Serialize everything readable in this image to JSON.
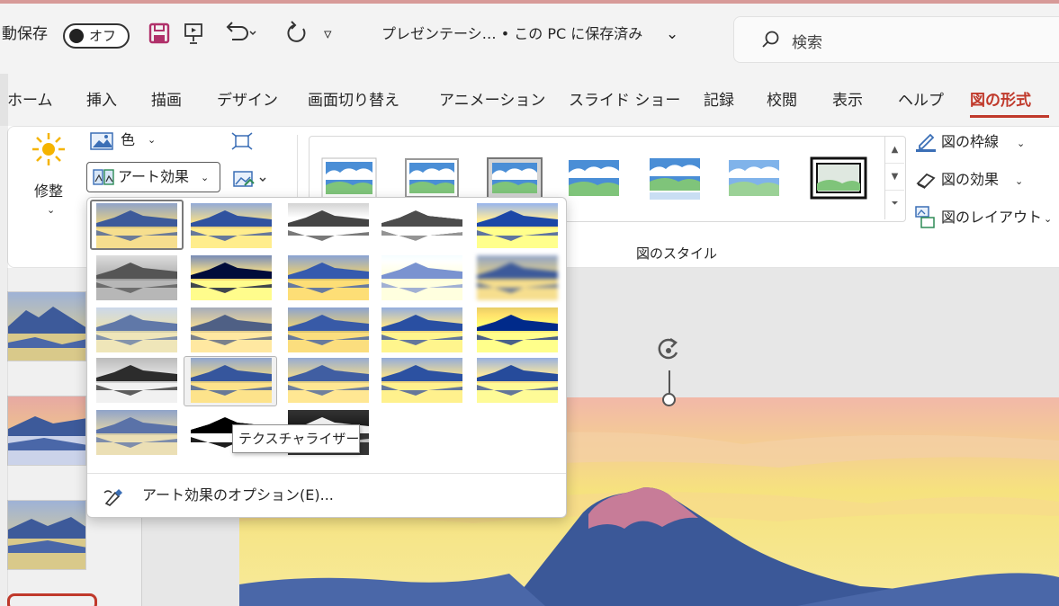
{
  "titlebar": {
    "autosave_label": "動保存",
    "toggle_label": "オフ",
    "document_title": "プレゼンテーシ… • この PC に保存済み",
    "title_chevron": "⌄",
    "search_placeholder": "検索",
    "qat_more": "▿"
  },
  "tabs": [
    {
      "label": "ホーム"
    },
    {
      "label": "挿入"
    },
    {
      "label": "描画"
    },
    {
      "label": "デザイン"
    },
    {
      "label": "画面切り替え"
    },
    {
      "label": "アニメーション"
    },
    {
      "label": "スライド ショー"
    },
    {
      "label": "記録"
    },
    {
      "label": "校閲"
    },
    {
      "label": "表示"
    },
    {
      "label": "ヘルプ"
    },
    {
      "label": "図の形式",
      "active": true
    }
  ],
  "ribbon": {
    "corrections_label": "修整",
    "color_label": "色",
    "art_effects_label": "アート効果",
    "chevron": "⌄",
    "picture_styles_group": "図のスタイル",
    "border_label": "図の枠線",
    "effects_label": "図の効果",
    "layout_label": "図のレイアウト"
  },
  "art_effects_menu": {
    "tooltip": "テクスチャライザー",
    "options_label": "アート効果のオプション(E)...",
    "effects": [
      {
        "name": "none"
      },
      {
        "name": "marker"
      },
      {
        "name": "pencil-grayscale"
      },
      {
        "name": "pencil-sketch"
      },
      {
        "name": "line-drawing"
      },
      {
        "name": "chalk-sketch"
      },
      {
        "name": "paint-strokes"
      },
      {
        "name": "paint-brush"
      },
      {
        "name": "glow-diffused"
      },
      {
        "name": "blur"
      },
      {
        "name": "mosaic-bubbles"
      },
      {
        "name": "light-screen"
      },
      {
        "name": "watercolor-sponge"
      },
      {
        "name": "film-grain"
      },
      {
        "name": "glass"
      },
      {
        "name": "cement"
      },
      {
        "name": "texturizer"
      },
      {
        "name": "crisscross-etching"
      },
      {
        "name": "pastels-smooth"
      },
      {
        "name": "plastic-wrap"
      },
      {
        "name": "cutout"
      },
      {
        "name": "photocopy"
      },
      {
        "name": "glow-edges"
      }
    ]
  },
  "colors": {
    "accent": "#c0392b",
    "sky_top": "#8fa3c9",
    "sky_bottom": "#f4d87a",
    "mountain": "#3d5a9a"
  }
}
